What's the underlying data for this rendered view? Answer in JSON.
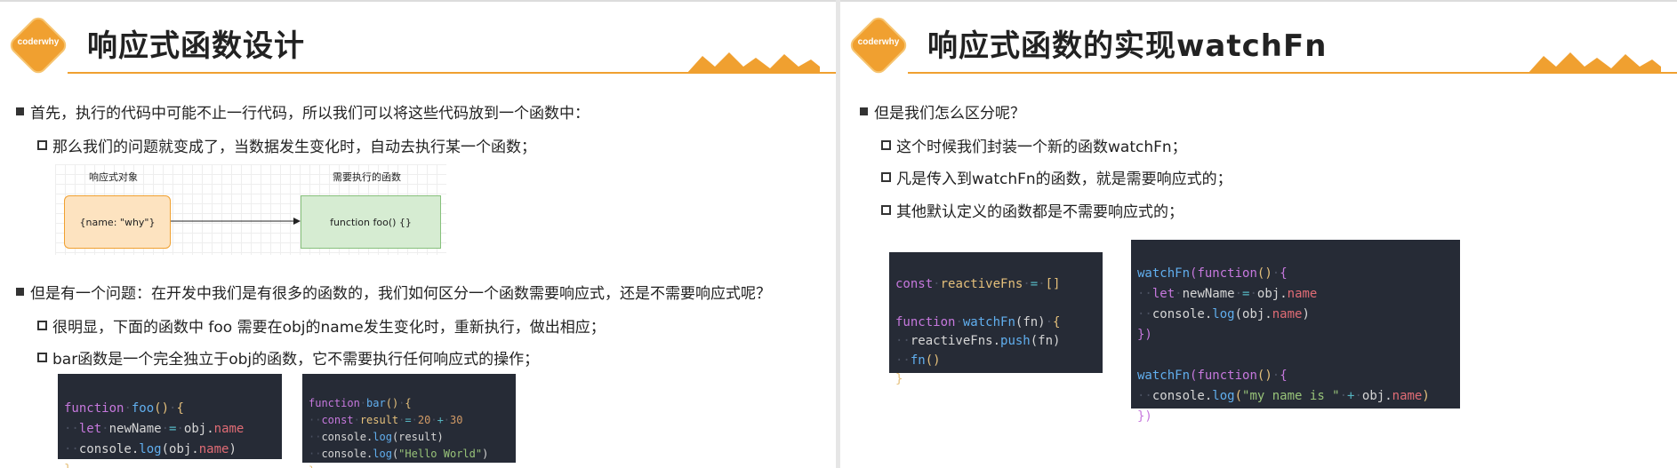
{
  "left": {
    "logo_text": "coderwhy",
    "title": "响应式函数设计",
    "bullets": [
      "首先，执行的代码中可能不止一行代码，所以我们可以将这些代码放到一个函数中：",
      "那么我们的问题就变成了，当数据发生变化时，自动去执行某一个函数；",
      "但是有一个问题：在开发中我们是有很多的函数的，我们如何区分一个函数需要响应式，还是不需要响应式呢？",
      "很明显，下面的函数中 foo 需要在obj的name发生变化时，重新执行，做出相应；",
      "bar函数是一个完全独立于obj的函数，它不需要执行任何响应式的操作；"
    ],
    "diagram": {
      "label_left": "响应式对象",
      "label_right": "需要执行的函数",
      "box_left": "{name: \"why\"}",
      "box_right": "function foo() {}"
    },
    "code_foo": {
      "kw_function": "function",
      "name": "foo",
      "paren_open": "()",
      "brace": "{",
      "kw_let": "let",
      "var": "newName",
      "eq": "=",
      "obj": "obj.",
      "prop": "name",
      "console": "console.",
      "log": "log",
      "arg_open": "(obj.",
      "arg_prop": "name",
      "arg_close": ")",
      "close": "}"
    },
    "code_bar": {
      "kw_function": "function",
      "name": "bar",
      "paren": "()",
      "brace": "{",
      "kw_const": "const",
      "var": "result",
      "eq": "=",
      "n1": "20",
      "plus": "+",
      "n2": "30",
      "console": "console.",
      "log": "log",
      "arg1": "(result)",
      "str": "\"Hello World\"",
      "open": "(",
      "close_paren": ")",
      "close": "}"
    }
  },
  "right": {
    "logo_text": "coderwhy",
    "title": "响应式函数的实现watchFn",
    "bullets": [
      "但是我们怎么区分呢？",
      "这个时候我们封装一个新的函数watchFn；",
      "凡是传入到watchFn的函数，就是需要响应式的；",
      "其他默认定义的函数都是不需要响应式的；"
    ],
    "code_a": {
      "kw_const": "const",
      "var": "reactiveFns",
      "eq": "=",
      "arr": "[]",
      "kw_function": "function",
      "name": "watchFn",
      "param": "(fn)",
      "brace": "{",
      "obj": "reactiveFns.",
      "push": "push",
      "push_arg": "(fn)",
      "call": "fn",
      "call_paren": "()",
      "close": "}"
    },
    "code_b": {
      "call": "watchFn",
      "open": "(",
      "kw_function": "function",
      "paren": "()",
      "brace": "{",
      "kw_let": "let",
      "var": "newName",
      "eq": "=",
      "obj": "obj.",
      "prop": "name",
      "console": "console.",
      "log": "log",
      "arg_open": "(obj.",
      "arg_prop": "name",
      "arg_close": ")",
      "close": "})",
      "str": "\"my name is \"",
      "plus": "+"
    }
  }
}
